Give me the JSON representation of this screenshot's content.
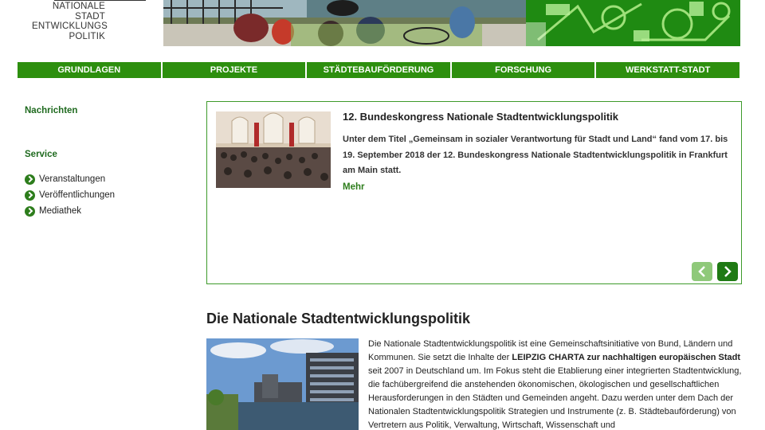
{
  "logo": {
    "lines": [
      "NATIONALE",
      "STADT",
      "ENTWICKLUNGS",
      "POLITIK"
    ]
  },
  "nav": {
    "items": [
      "GRUNDLAGEN",
      "PROJEKTE",
      "STÄDTEBAUFÖRDERUNG",
      "FORSCHUNG",
      "WERKSTATT-STADT"
    ]
  },
  "sidebar": {
    "heading_news": "Nachrichten",
    "heading_service": "Service",
    "items": [
      "Veranstaltungen",
      "Veröffentlichungen",
      "Mediathek"
    ]
  },
  "teaser": {
    "title": "12. Bundeskongress Nationale Stadtentwicklungspolitik",
    "text": "Unter dem Titel „Gemeinsam in sozialer Verantwortung für Stadt und Land“ fand vom 17. bis 19. September 2018 der 12. Bundeskongress Nationale Stadtentwicklungspolitik in Frankfurt am Main statt.",
    "more_label": "Mehr"
  },
  "main": {
    "title": "Die Nationale Stadtentwicklungspolitik",
    "text_before": "Die Nationale Stadtentwicklungspolitik ist eine Gemeinschaftsinitiative von Bund, Ländern und Kommunen. Sie setzt die Inhalte der ",
    "text_bold": "LEIPZIG CHARTA zur nachhaltigen europäischen Stadt",
    "text_after": " seit 2007 in Deutschland um. Im Fokus steht die Etablierung einer integrierten Stadtentwicklung, die fachübergreifend die anstehenden ökonomischen, ökologischen und gesellschaftlichen Herausforderungen in den Städten und Gemeinden angeht. Dazu werden unter dem Dach der Nationalen Stadtentwicklungspolitik Strategien und Instrumente (z. B. Städtebauförderung) von Vertretern aus Politik, Verwaltung, Wirtschaft, Wissenschaft und"
  },
  "colors": {
    "brand_green": "#2d8f0e",
    "heading_green": "#1f6a1f",
    "border_green": "#3d9a2a"
  },
  "icons": [
    "bullet-arrow-icon",
    "chevron-left-icon",
    "chevron-right-icon"
  ]
}
